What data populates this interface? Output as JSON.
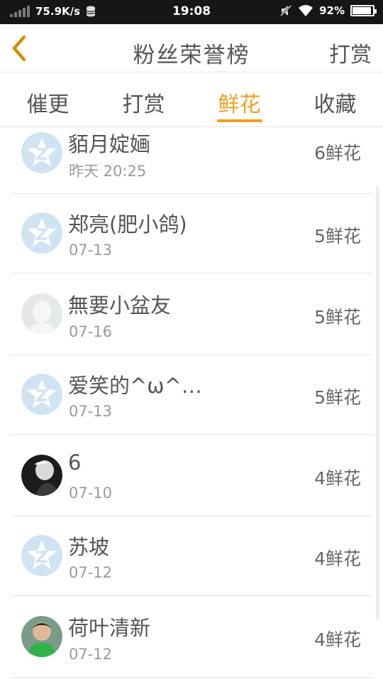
{
  "status_bar": {
    "network_speed": "75.9K/s",
    "time": "19:08",
    "battery": "92%",
    "battery_level": 0.92,
    "icons": [
      "signal-icon",
      "database-icon",
      "mute-icon",
      "wifi-icon",
      "battery-icon"
    ]
  },
  "header": {
    "title": "粉丝荣誉榜",
    "back_icon": "chevron-left-icon",
    "right_action": "打赏",
    "accent_color": "#f0a01e"
  },
  "tabs": [
    {
      "label": "催更",
      "active": false
    },
    {
      "label": "打赏",
      "active": false
    },
    {
      "label": "鲜花",
      "active": true
    },
    {
      "label": "收藏",
      "active": false
    }
  ],
  "rank_list": [
    {
      "name": "貊月婝婳",
      "date": "昨天 20:25",
      "count": "6鲜花",
      "avatar": "qq-default-avatar-icon"
    },
    {
      "name": "郑亮(肥小鸽)",
      "date": "07-13",
      "count": "5鲜花",
      "avatar": "qq-default-avatar-icon"
    },
    {
      "name": "無要小盆友",
      "date": "07-16",
      "count": "5鲜花",
      "avatar": "silhouette-avatar-icon"
    },
    {
      "name": "爱笑的^ω^…",
      "date": "07-13",
      "count": "5鲜花",
      "avatar": "qq-default-avatar-icon"
    },
    {
      "name": "6",
      "date": "07-10",
      "count": "4鲜花",
      "avatar": "photo-avatar"
    },
    {
      "name": "苏坡",
      "date": "07-12",
      "count": "4鲜花",
      "avatar": "qq-default-avatar-icon"
    },
    {
      "name": "荷叶清新",
      "date": "07-12",
      "count": "4鲜花",
      "avatar": "photo-avatar"
    }
  ]
}
